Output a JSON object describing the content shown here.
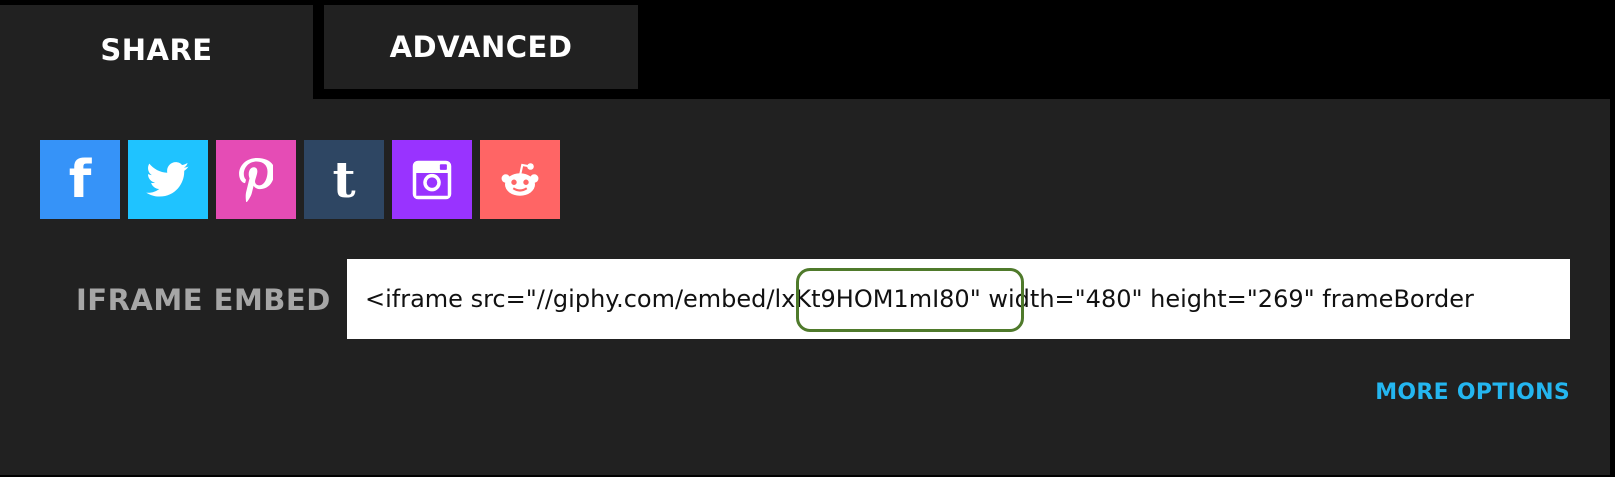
{
  "tabs": [
    {
      "label": "SHARE",
      "active": true
    },
    {
      "label": "ADVANCED",
      "active": false
    }
  ],
  "social": [
    {
      "name": "facebook",
      "glyph": "f",
      "color": "#3693f8"
    },
    {
      "name": "twitter",
      "color": "#1fc3ff"
    },
    {
      "name": "pinterest",
      "color": "#e54cb5"
    },
    {
      "name": "tumblr",
      "glyph": "t",
      "color": "#2e4663"
    },
    {
      "name": "instagram",
      "color": "#9933ff"
    },
    {
      "name": "reddit",
      "color": "#ff6565"
    }
  ],
  "embed": {
    "label": "IFRAME EMBED",
    "code_before": "<iframe src=\"//giphy.com/embed/",
    "code_id": "lxKt9HOM1mI80",
    "code_after": "\" width=\"480\" height=\"269\" frameBorder",
    "highlight_color": "#4f7a2b"
  },
  "more_options": "MORE OPTIONS",
  "colors": {
    "panel": "#212121",
    "background": "#000000",
    "link": "#24b6f0"
  }
}
